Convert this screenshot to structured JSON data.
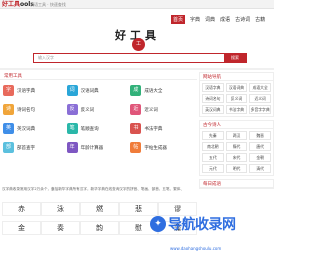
{
  "topbar": {
    "logo_a": "好工具",
    "logo_b": "ools",
    "slogan": "汉语工具 · 快速查找"
  },
  "nav": [
    "首页",
    "字典",
    "词典",
    "成语",
    "古诗词",
    "古籍"
  ],
  "brand": {
    "title": "好工具",
    "seal": "工"
  },
  "search": {
    "placeholder": "输入汉字",
    "button": "搜索"
  },
  "main": {
    "title": "常用工具",
    "tools": [
      {
        "label": "汉语字典",
        "icon": "字",
        "color": "#e86a5c"
      },
      {
        "label": "汉语词典",
        "icon": "词",
        "color": "#2aa6d8"
      },
      {
        "label": "成语大全",
        "icon": "成",
        "color": "#32b17a"
      },
      {
        "label": "诗词名句",
        "icon": "诗",
        "color": "#f0a53a"
      },
      {
        "label": "反义词",
        "icon": "反",
        "color": "#8a6fd6"
      },
      {
        "label": "近义词",
        "icon": "近",
        "color": "#e0567a"
      },
      {
        "label": "英汉词典",
        "icon": "英",
        "color": "#3f8ee8"
      },
      {
        "label": "笔顺查询",
        "icon": "笔",
        "color": "#2ab7a9"
      },
      {
        "label": "书法字典",
        "icon": "书",
        "color": "#d9534f"
      },
      {
        "label": "部首查字",
        "icon": "部",
        "color": "#5bc0de"
      },
      {
        "label": "年龄计算器",
        "icon": "年",
        "color": "#7e57c2"
      },
      {
        "label": "字帖生成器",
        "icon": "帖",
        "color": "#f07c3a"
      }
    ]
  },
  "description": {
    "text": "汉字典收录常用汉字2万余个，囊括新华字典所有汉字，新华字典在线查询汉字的拼音、笔画、部首、五笔、繁体、"
  },
  "chars": [
    "赤",
    "泳",
    "燃",
    "悲",
    "谬",
    "金",
    "奏",
    "韵",
    "慰",
    "藻"
  ],
  "right": {
    "box1": {
      "title": "网站导航",
      "items": [
        "汉语字典",
        "汉语词典",
        "成语大全",
        "诗词名句",
        "反义词",
        "近义词",
        "英汉词典",
        "书法字典",
        "多音字字典"
      ]
    },
    "box2": {
      "title": "古今诗人",
      "items": [
        "先秦",
        "两汉",
        "魏晋",
        "南北朝",
        "隋代",
        "唐代",
        "五代",
        "宋代",
        "金朝",
        "元代",
        "明代",
        "清代"
      ]
    },
    "box3": {
      "title": "每日成语"
    }
  },
  "watermark": {
    "text": "导航收录网",
    "url": "www.daohangshoulu.com"
  }
}
